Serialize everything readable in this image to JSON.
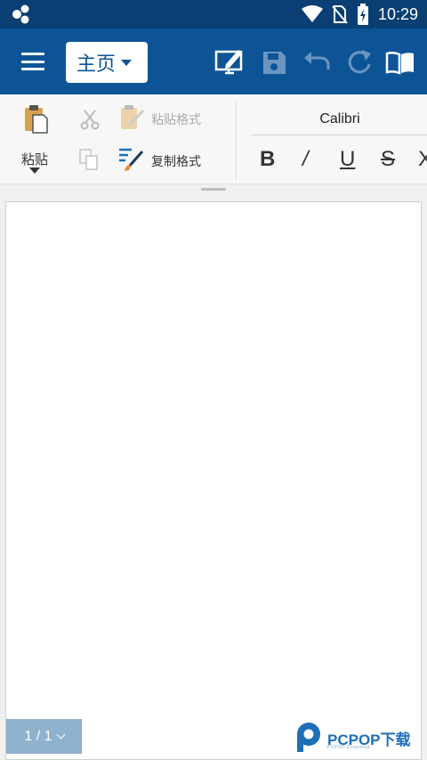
{
  "status_bar": {
    "time": "10:29",
    "icons": [
      "app-notification-icon",
      "wifi-icon",
      "no-sim-icon",
      "battery-charging-icon"
    ]
  },
  "app_bar": {
    "tab_label": "主页",
    "actions": [
      "edit-view-icon",
      "save-icon",
      "undo-icon",
      "redo-icon",
      "read-mode-icon"
    ]
  },
  "ribbon": {
    "paste_label": "粘贴",
    "paste_format_label": "粘贴格式",
    "copy_format_label": "复制格式",
    "font_name": "Calibri",
    "format_buttons": {
      "bold": "B",
      "italic": "/",
      "underline": "U",
      "strike": "S",
      "more": "X"
    }
  },
  "page_indicator": "1 / 1",
  "watermark": {
    "text": "PCPOP下载",
    "subtext": "PCPOP Download"
  },
  "colors": {
    "status_bar": "#0a3f73",
    "app_bar": "#0d5497",
    "ribbon": "#f7f7f7",
    "pager": "#8fb2cf",
    "watermark": "#1d6fb8"
  }
}
